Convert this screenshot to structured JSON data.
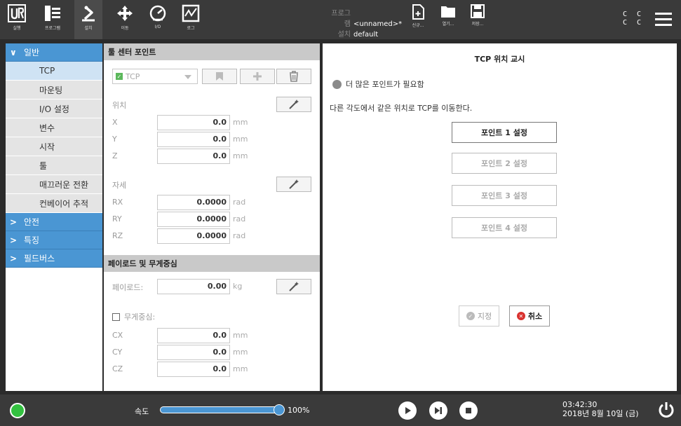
{
  "header": {
    "tabs": [
      {
        "label": "실행"
      },
      {
        "label": "프로그램"
      },
      {
        "label": "설치"
      },
      {
        "label": "이동"
      },
      {
        "label": "I/O"
      },
      {
        "label": "로그"
      }
    ],
    "program_key": "프로그램",
    "program_value": "<unnamed>*",
    "install_key": "설치",
    "install_value": "default",
    "file_buttons": [
      {
        "label": "신규..."
      },
      {
        "label": "열기..."
      },
      {
        "label": "저장..."
      }
    ],
    "cc_line1": "C C",
    "cc_line2": "C C"
  },
  "sidebar": {
    "sections": [
      {
        "label": "일반",
        "expanded": true
      },
      {
        "label": "안전",
        "expanded": false
      },
      {
        "label": "특징",
        "expanded": false
      },
      {
        "label": "필드버스",
        "expanded": false
      }
    ],
    "items": [
      {
        "label": "TCP",
        "selected": true
      },
      {
        "label": "마운팅"
      },
      {
        "label": "I/O 설정"
      },
      {
        "label": "변수"
      },
      {
        "label": "시작"
      },
      {
        "label": "툴"
      },
      {
        "label": "매끄러운 전환"
      },
      {
        "label": "컨베이어 추적"
      }
    ]
  },
  "tcp_panel": {
    "title": "툴 센터 포인트",
    "tcp_select": "TCP",
    "position_label": "위치",
    "position": [
      {
        "axis": "X",
        "value": "0.0",
        "unit": "mm"
      },
      {
        "axis": "Y",
        "value": "0.0",
        "unit": "mm"
      },
      {
        "axis": "Z",
        "value": "0.0",
        "unit": "mm"
      }
    ],
    "orientation_label": "자세",
    "orientation": [
      {
        "axis": "RX",
        "value": "0.0000",
        "unit": "rad"
      },
      {
        "axis": "RY",
        "value": "0.0000",
        "unit": "rad"
      },
      {
        "axis": "RZ",
        "value": "0.0000",
        "unit": "rad"
      }
    ]
  },
  "payload_panel": {
    "title": "페이로드 및 무게중심",
    "payload_label": "페이로드:",
    "payload_value": "0.00",
    "payload_unit": "kg",
    "cog_label": "무게중심:",
    "cog": [
      {
        "axis": "CX",
        "value": "0.0",
        "unit": "mm"
      },
      {
        "axis": "CY",
        "value": "0.0",
        "unit": "mm"
      },
      {
        "axis": "CZ",
        "value": "0.0",
        "unit": "mm"
      }
    ]
  },
  "teach": {
    "title": "TCP 위치 교시",
    "status": "더 많은 포인트가 필요함",
    "instruction": "다른 각도에서 같은 위치로 TCP를 이동한다.",
    "points": [
      {
        "label": "포인트 1 설정",
        "enabled": true
      },
      {
        "label": "포인트 2 설정",
        "enabled": false
      },
      {
        "label": "포인트 3 설정",
        "enabled": false
      },
      {
        "label": "포인트 4 설정",
        "enabled": false
      }
    ],
    "ok_label": "지정",
    "cancel_label": "취소"
  },
  "footer": {
    "speed_label": "속도",
    "speed_value": "100%",
    "speed_fraction": 1.0,
    "time": "03:42:30",
    "date": "2018년 8월 10일 (금)"
  },
  "colors": {
    "accent": "#4a96d3",
    "header_bg": "#3a3a3a",
    "status_green": "#33c140",
    "cancel_red": "#d9322f"
  }
}
